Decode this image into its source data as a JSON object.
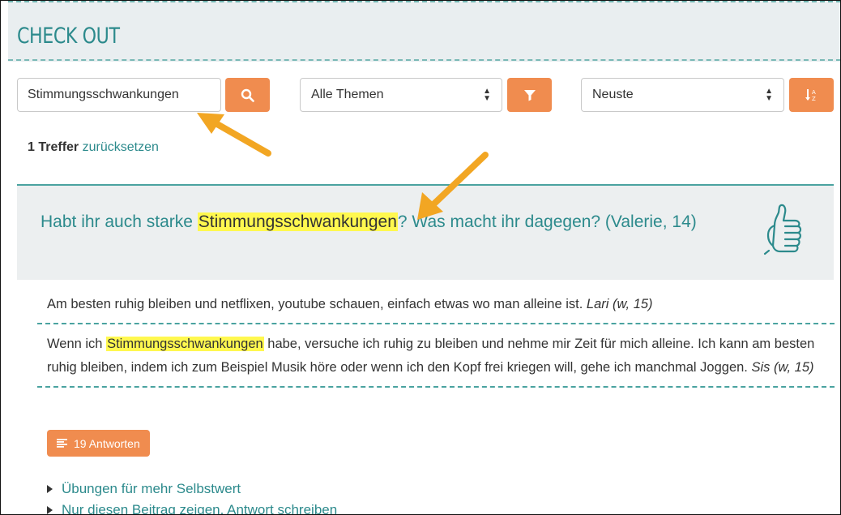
{
  "header": {
    "title": "CHECK OUT"
  },
  "search": {
    "value": "Stimmungsschwankungen"
  },
  "filters": {
    "topic_selected": "Alle Themen",
    "sort_selected": "Neuste"
  },
  "results": {
    "count_label": "1 Treffer",
    "reset_label": "zurücksetzen"
  },
  "question": {
    "text_before": "Habt ihr auch starke ",
    "highlight": "Stimmungsschwankungen",
    "text_after": "? Was macht ihr dagegen? (Valerie, 14)"
  },
  "answers": [
    {
      "text": "Am besten ruhig bleiben und netflixen, youtube schauen, einfach etwas wo man alleine ist. ",
      "author": "Lari (w, 15)"
    },
    {
      "text_before": "Wenn ich ",
      "highlight": "Stimmungsschwankungen",
      "text_after": " habe, versuche ich ruhig zu bleiben und nehme mir Zeit für mich alleine. Ich kann am besten ruhig bleiben, indem ich zum Beispiel Musik höre oder wenn ich den Kopf frei kriegen will, gehe ich manchmal Joggen. ",
      "author": "Sis (w, 15)"
    }
  ],
  "responses_button": {
    "label": "19 Antworten"
  },
  "links": [
    {
      "label": "Übungen für mehr Selbstwert"
    },
    {
      "label": "Nur diesen Beitrag zeigen. Antwort schreiben"
    }
  ],
  "colors": {
    "accent": "#f08c4f",
    "teal": "#2c8a8c",
    "highlight": "#fff84f"
  }
}
